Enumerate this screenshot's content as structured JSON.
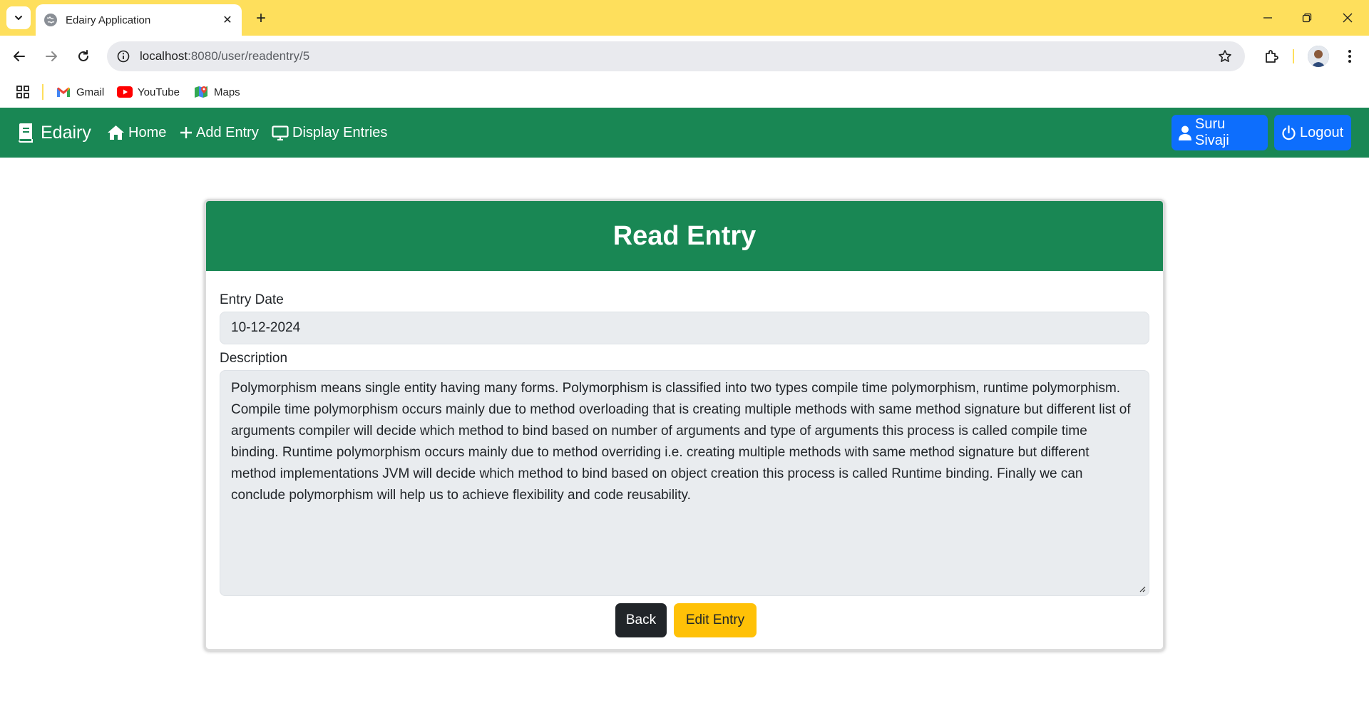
{
  "browser": {
    "tab_title": "Edairy Application",
    "url_host": "localhost",
    "url_path": ":8080/user/readentry/5",
    "bookmarks": [
      {
        "label": "Gmail",
        "icon": "gmail-icon"
      },
      {
        "label": "YouTube",
        "icon": "youtube-icon"
      },
      {
        "label": "Maps",
        "icon": "maps-icon"
      }
    ],
    "tabstrip_color": "#fedf5c"
  },
  "navbar": {
    "brand": "Edairy",
    "links": {
      "home": "Home",
      "add_entry": "Add Entry",
      "display_entries": "Display Entries"
    },
    "user_button": "Suru Sivaji",
    "logout_button": "Logout",
    "background": "#198754",
    "button_color": "#0d6efd"
  },
  "card": {
    "title": "Read Entry",
    "entry_date_label": "Entry Date",
    "entry_date_value": "10-12-2024",
    "description_label": "Description",
    "description_value": "Polymorphism means single entity having many forms. Polymorphism is classified into two types compile time polymorphism, runtime polymorphism. Compile time polymorphism occurs mainly due to method overloading that is creating multiple methods with same method signature but different list of arguments compiler will decide which method to bind based on number of arguments and type of arguments this process is called compile time binding. Runtime polymorphism occurs mainly due to method overriding i.e. creating multiple methods with same method signature but different method implementations JVM will decide which method to bind based on object creation this process is called Runtime binding. Finally we can conclude polymorphism will help us to achieve flexibility and code reusability.",
    "back_button": "Back",
    "edit_button": "Edit Entry",
    "edit_button_color": "#ffc107"
  }
}
